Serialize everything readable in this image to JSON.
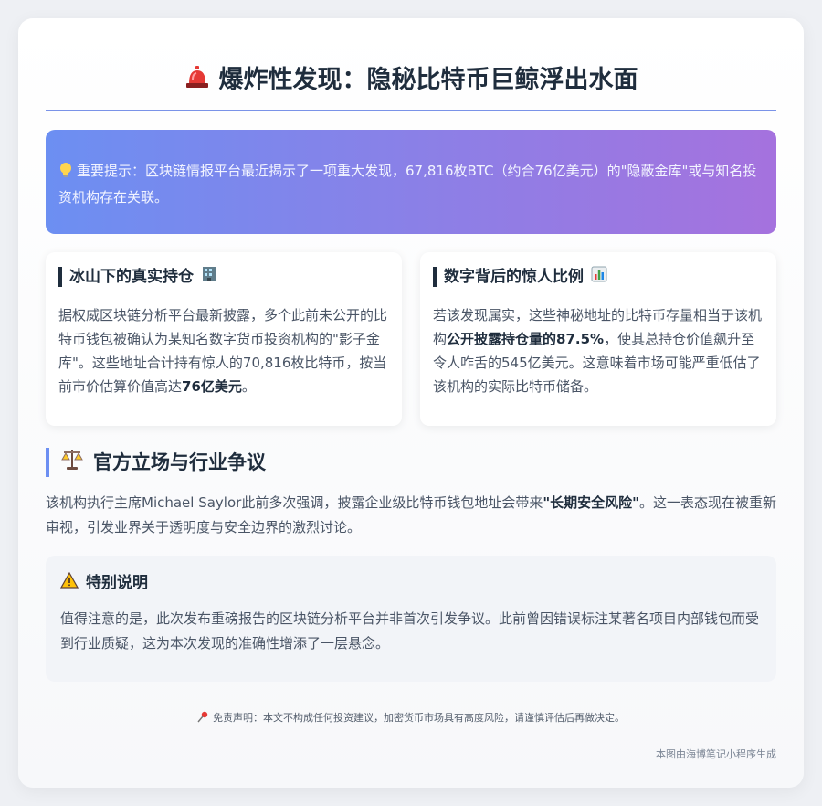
{
  "header": {
    "title": "爆炸性发现：隐秘比特币巨鲸浮出水面",
    "icon": "siren-icon"
  },
  "alert": {
    "icon": "lightbulb-icon",
    "text": "重要提示：区块链情报平台最近揭示了一项重大发现，67,816枚BTC（约合76亿美元）的\"隐蔽金库\"或与知名投资机构存在关联。"
  },
  "panels": [
    {
      "title": "冰山下的真实持仓",
      "icon": "building-icon",
      "text_before": "据权威区块链分析平台最新披露，多个此前未公开的比特币钱包被确认为某知名数字货币投资机构的\"影子金库\"。这些地址合计持有惊人的70,816枚比特币，按当前市价估算价值高达",
      "highlight": "76亿美元",
      "text_after": "。"
    },
    {
      "title": "数字背后的惊人比例",
      "icon": "bar-chart-icon",
      "text_before": "若该发现属实，这些神秘地址的比特币存量相当于该机构",
      "highlight": "公开披露持仓量的87.5%",
      "text_after": "，使其总持仓价值飙升至令人咋舌的545亿美元。这意味着市场可能严重低估了该机构的实际比特币储备。"
    }
  ],
  "section": {
    "icon": "scales-icon",
    "title": "官方立场与行业争议",
    "text_before": "该机构执行主席Michael Saylor此前多次强调，披露企业级比特币钱包地址会带来",
    "highlight": "\"长期安全风险\"",
    "text_after": "。这一表态现在被重新审视，引发业界关于透明度与安全边界的激烈讨论。"
  },
  "note": {
    "icon": "warning-icon",
    "title": "特别说明",
    "text": "值得注意的是，此次发布重磅报告的区块链分析平台并非首次引发争议。此前曾因错误标注某著名项目内部钱包而受到行业质疑，这为本次发现的准确性增添了一层悬念。"
  },
  "disclaimer": {
    "icon": "pushpin-icon",
    "text": "免责声明：本文不构成任何投资建议，加密货币市场具有高度风险，请谨慎评估后再做决定。"
  },
  "footer": {
    "text": "本图由海博笔记小程序生成"
  },
  "colors": {
    "accent": "#6c8ff2",
    "gradient_end": "#a572de",
    "heading": "#1f2d3d",
    "body_text": "#4a5566"
  }
}
